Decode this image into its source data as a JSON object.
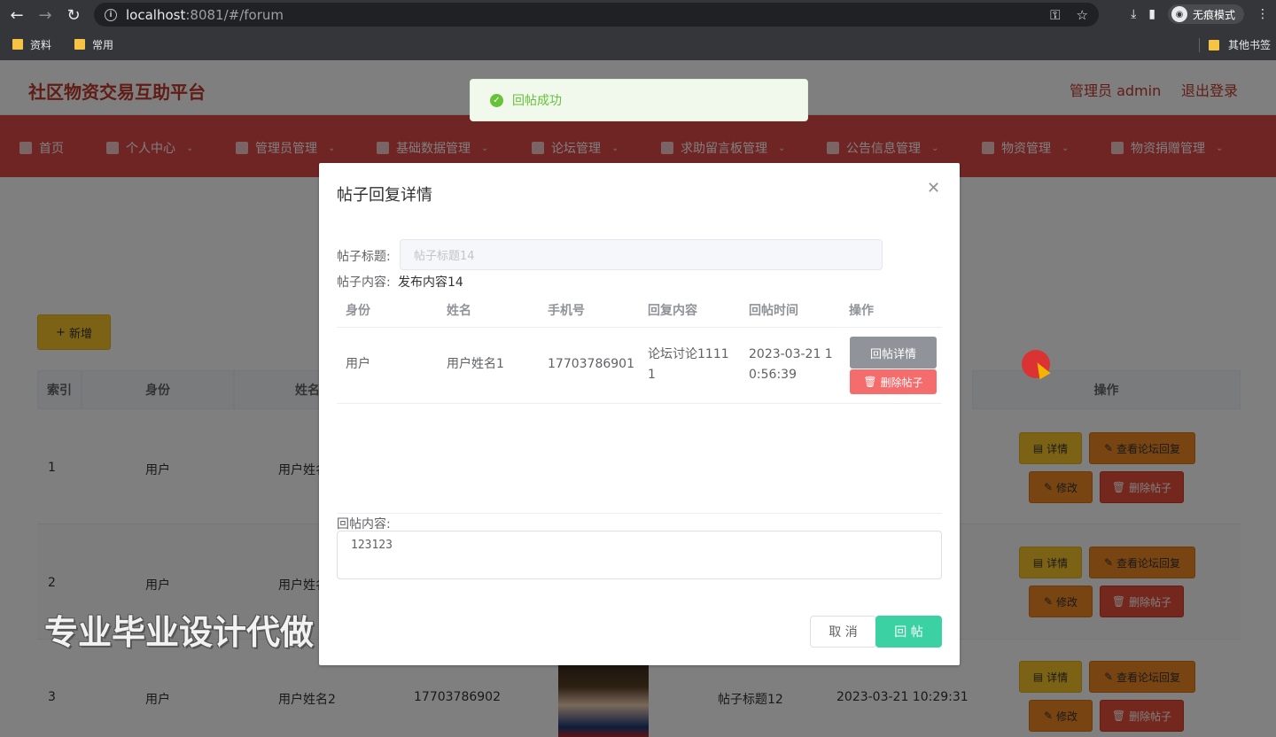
{
  "browser": {
    "url_host": "localhost",
    "url_path": ":8081/#/forum",
    "incognito_label": "无痕模式",
    "bookmarks": [
      "资料",
      "常用"
    ],
    "other_bookmarks": "其他书签"
  },
  "header": {
    "site_title": "社区物资交易互助平台",
    "admin_label": "管理员 admin",
    "logout_label": "退出登录"
  },
  "menu": [
    "首页",
    "个人中心",
    "管理员管理",
    "基础数据管理",
    "论坛管理",
    "求助留言板管理",
    "公告信息管理",
    "物资管理",
    "物资捐赠管理"
  ],
  "toolbar": {
    "add_label": "新增"
  },
  "table": {
    "headers": {
      "index": "索引",
      "identity": "身份",
      "name": "姓名",
      "actions": "操作"
    },
    "rows": [
      {
        "index": "1",
        "identity": "用户",
        "name": "用户姓名1",
        "phone": "",
        "title": "",
        "time": ""
      },
      {
        "index": "2",
        "identity": "用户",
        "name": "用户姓名1",
        "phone": "",
        "title": "",
        "time": ""
      },
      {
        "index": "3",
        "identity": "用户",
        "name": "用户姓名2",
        "phone": "17703786902",
        "title": "帖子标题12",
        "time": "2023-03-21 10:29:31"
      }
    ],
    "action_labels": {
      "detail": "详情",
      "view_replies": "查看论坛回复",
      "edit": "修改",
      "delete": "删除帖子"
    }
  },
  "toast": {
    "message": "回帖成功"
  },
  "dialog": {
    "title": "帖子回复详情",
    "post_title_label": "帖子标题:",
    "post_title_value": "帖子标题14",
    "post_content_label": "帖子内容:",
    "post_content_value": "发布内容14",
    "columns": [
      "身份",
      "姓名",
      "手机号",
      "回复内容",
      "回帖时间",
      "操作"
    ],
    "row": {
      "identity": "用户",
      "name": "用户姓名1",
      "phone": "17703786901",
      "content_line1": "论坛讨论1111",
      "content_line2": "1",
      "time_line1": "2023-03-21 1",
      "time_line2": "0:56:39",
      "detail_btn": "回帖详情",
      "delete_btn": "删除帖子"
    },
    "reply_label": "回帖内容:",
    "reply_value": "123123",
    "cancel_label": "取 消",
    "submit_label": "回 帖"
  },
  "watermark": "专业毕业设计代做"
}
